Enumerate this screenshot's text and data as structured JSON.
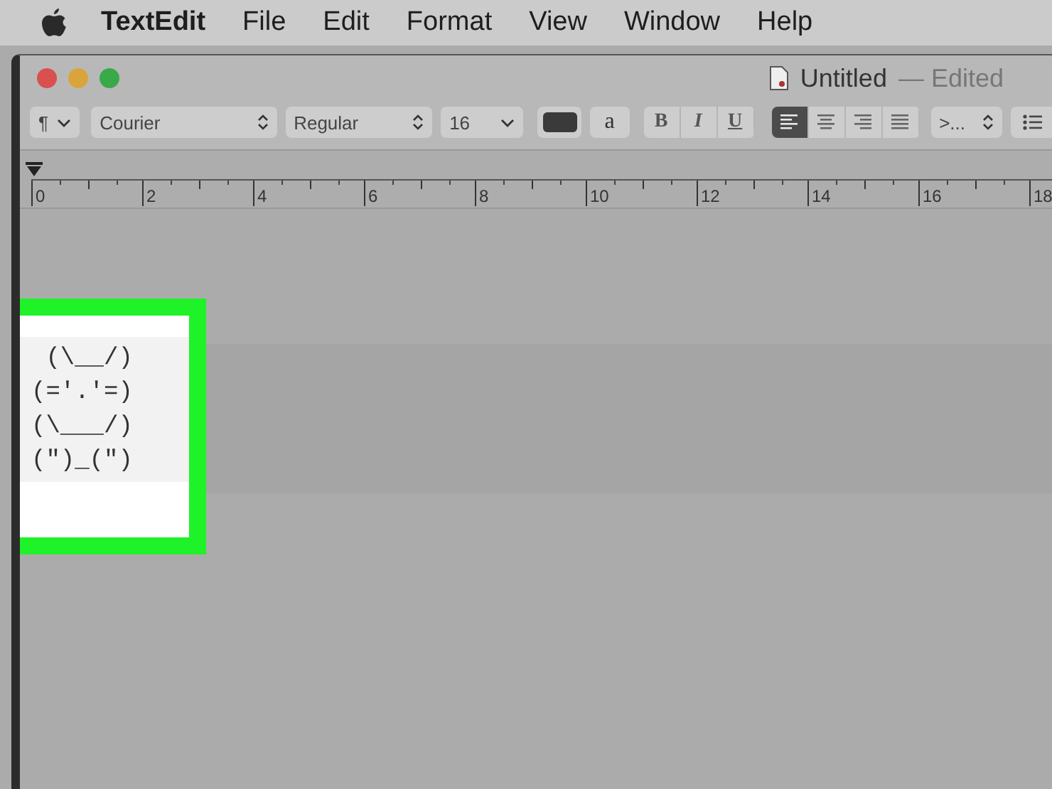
{
  "menu_bar": {
    "items": [
      {
        "label": "TextEdit",
        "kind": "app"
      },
      {
        "label": "File",
        "kind": "menu"
      },
      {
        "label": "Edit",
        "kind": "menu"
      },
      {
        "label": "Format",
        "kind": "menu"
      },
      {
        "label": "View",
        "kind": "menu"
      },
      {
        "label": "Window",
        "kind": "menu"
      },
      {
        "label": "Help",
        "kind": "menu"
      }
    ]
  },
  "window": {
    "title": "Untitled",
    "status": "— Edited"
  },
  "toolbar": {
    "paragraph": "¶",
    "font_family": "Courier",
    "font_style": "Regular",
    "font_size": "16",
    "highlight_label": "a",
    "style_buttons": [
      {
        "label": "B",
        "kind": "bold"
      },
      {
        "label": "I",
        "kind": "italic"
      },
      {
        "label": "U",
        "kind": "underline"
      }
    ],
    "alignment_buttons": [
      {
        "kind": "left",
        "selected": true
      },
      {
        "kind": "center",
        "selected": false
      },
      {
        "kind": "right",
        "selected": false
      },
      {
        "kind": "justify",
        "selected": false
      }
    ],
    "spacing": ">..."
  },
  "ruler": {
    "labels": [
      "0",
      "2",
      "4",
      "6",
      "8",
      "10",
      "12",
      "14",
      "16",
      "18"
    ]
  },
  "document": {
    "lines": [
      " (\\__/)",
      "(='.'=)",
      "(\\___/)",
      "(\")_(\")"
    ]
  }
}
